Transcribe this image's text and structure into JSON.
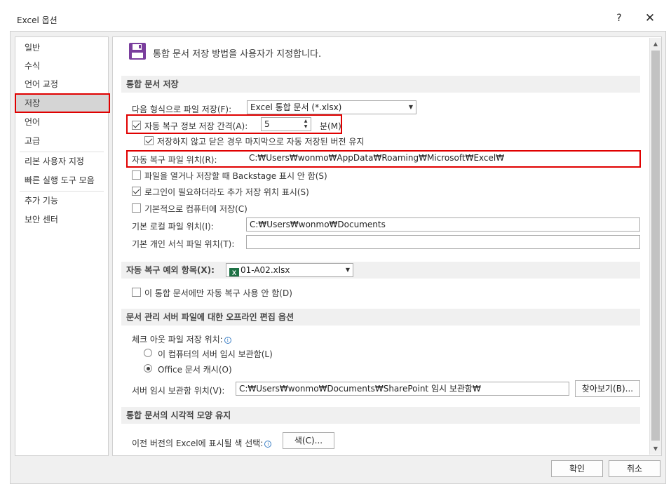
{
  "window": {
    "title": "Excel 옵션",
    "help_label": "?",
    "close_label": "✕"
  },
  "sidebar": {
    "items": [
      {
        "label": "일반"
      },
      {
        "label": "수식"
      },
      {
        "label": "언어 교정"
      },
      {
        "label": "저장",
        "selected": true
      },
      {
        "label": "언어"
      },
      {
        "label": "고급"
      },
      {
        "label": "리본 사용자 지정"
      },
      {
        "label": "빠른 실행 도구 모음"
      },
      {
        "label": "추가 기능"
      },
      {
        "label": "보안 센터"
      }
    ]
  },
  "header": {
    "icon": "save-icon",
    "text": "통합 문서 저장 방법을 사용자가 지정합니다."
  },
  "save_section": {
    "title": "통합 문서 저장",
    "format_label": "다음 형식으로 파일 저장(F):",
    "format_value": "Excel 통합 문서 (*.xlsx)",
    "autorecover_label": "자동 복구 정보 저장 간격(A):",
    "autorecover_checked": true,
    "autorecover_minutes": "5",
    "minutes_unit": "분(M)",
    "keep_last_label": "저장하지 않고 닫은 경우 마지막으로 자동 저장된 버전 유지",
    "keep_last_checked": true,
    "autorecover_location_label": "자동 복구 파일 위치(R):",
    "autorecover_location_value": "C:₩Users₩wonmo₩AppData₩Roaming₩Microsoft₩Excel₩",
    "backstage_label": "파일을 열거나 저장할 때 Backstage 표시 안 함(S)",
    "backstage_checked": false,
    "signin_label": "로그인이 필요하더라도 추가 저장 위치 표시(S)",
    "signin_checked": true,
    "default_local_label": "기본적으로 컴퓨터에 저장(C)",
    "default_local_checked": false,
    "local_file_location_label": "기본 로컬 파일 위치(I):",
    "local_file_location_value": "C:₩Users₩wonmo₩Documents",
    "personal_templates_label": "기본 개인 서식 파일 위치(T):",
    "personal_templates_value": ""
  },
  "exceptions_section": {
    "title": "자동 복구 예외 항목(X):",
    "workbook_value": "01-A02.xlsx",
    "disable_label": "이 통합 문서에만 자동 복구 사용 안 함(D)",
    "disable_checked": false
  },
  "offline_section": {
    "title": "문서 관리 서버 파일에 대한 오프라인 편집 옵션",
    "checkout_label": "체크 아웃 파일 저장 위치:",
    "option_server_drafts": "이 컴퓨터의 서버 임시 보관함(L)",
    "option_office_cache": "Office 문서 캐시(O)",
    "selected_option": "office_cache",
    "server_drafts_label": "서버 임시 보관함 위치(V):",
    "server_drafts_value": "C:₩Users₩wonmo₩Documents₩SharePoint 임시 보관함₩",
    "browse_label": "찾아보기(B)..."
  },
  "visual_section": {
    "title": "통합 문서의 시각적 모양 유지",
    "colors_label": "이전 버전의 Excel에 표시될 색 선택:",
    "colors_button": "색(C)..."
  },
  "footer": {
    "ok_label": "확인",
    "cancel_label": "취소"
  },
  "colors": {
    "highlight_red": "#e00000",
    "accent_purple": "#7a3e9d",
    "excel_green": "#1e7145"
  }
}
